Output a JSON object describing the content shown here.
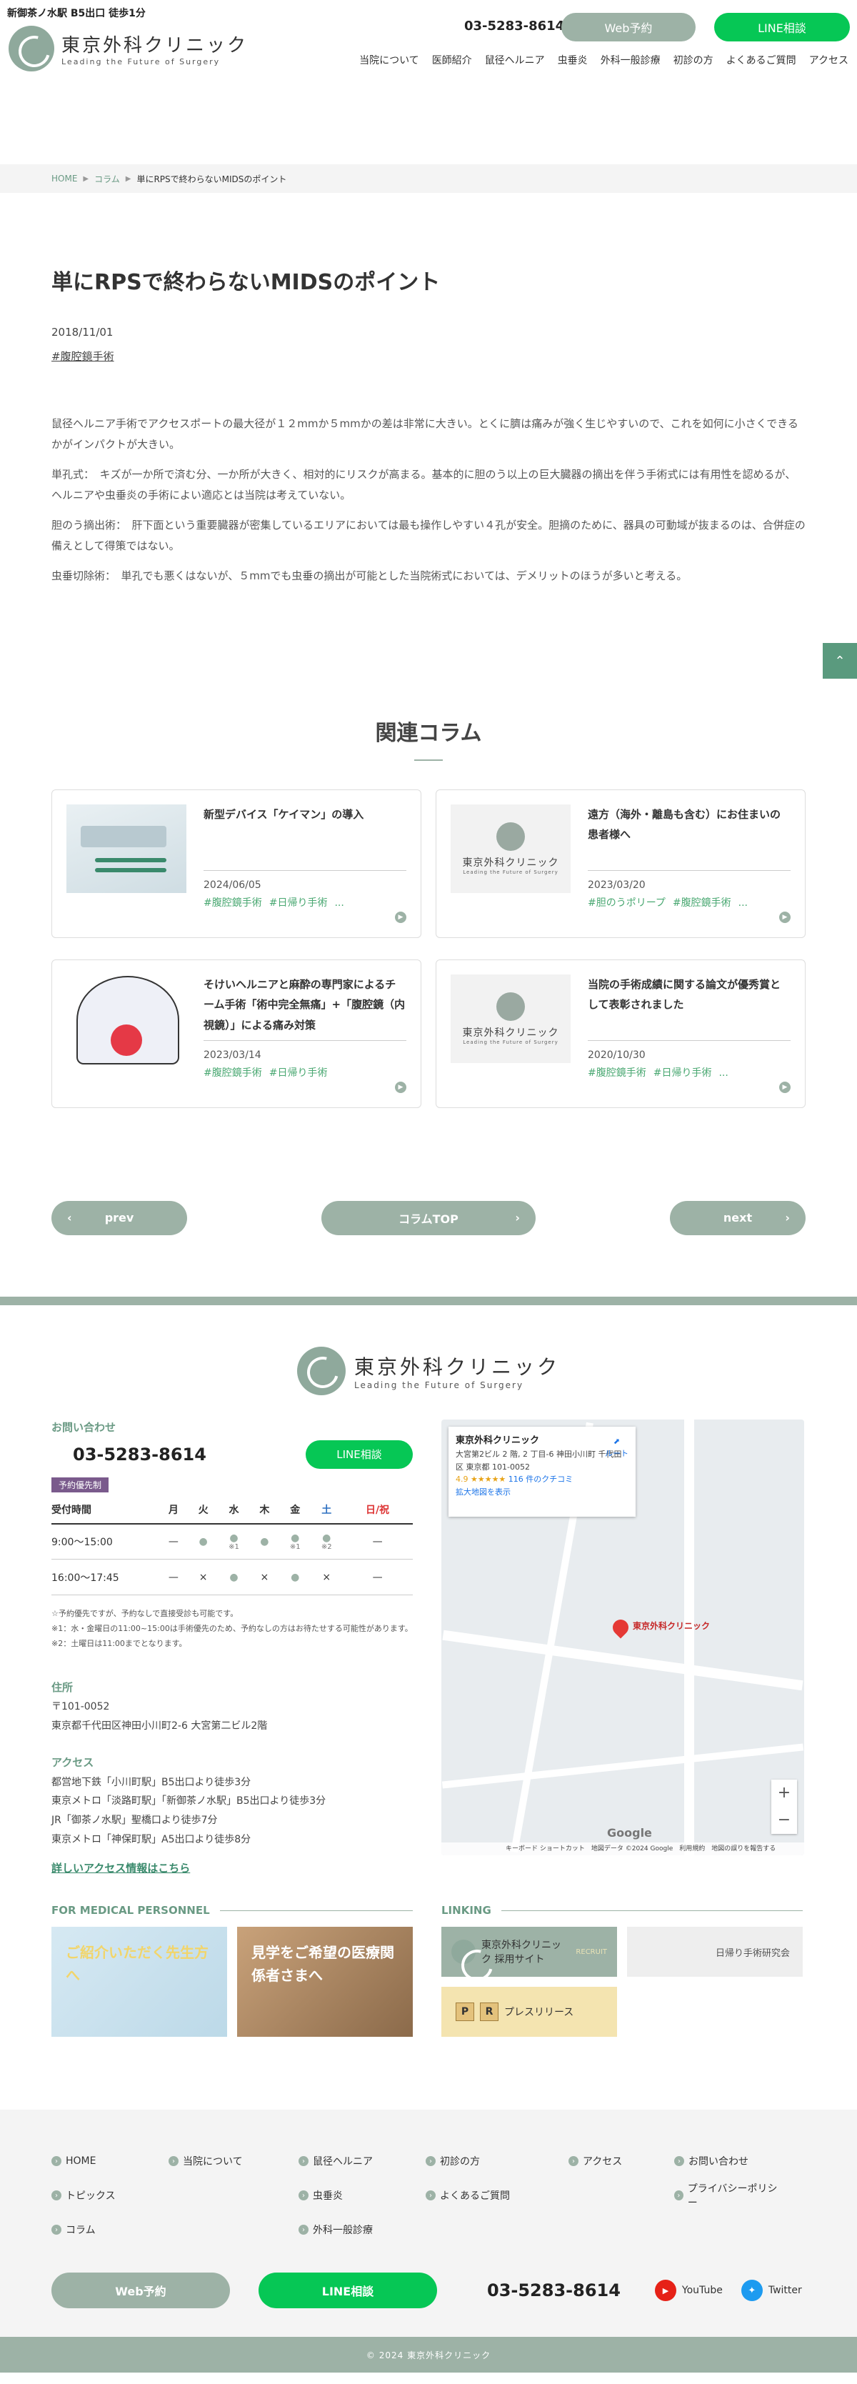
{
  "header": {
    "station": "新御茶ノ水駅 B5出口 徒歩1分",
    "logo_jp": "東京外科クリニック",
    "logo_en": "Leading the Future of Surgery",
    "phone": "03-5283-8614",
    "web_btn": "Web予約",
    "line_btn": "LINE相談",
    "nav": [
      "当院について",
      "医師紹介",
      "鼠径ヘルニア",
      "虫垂炎",
      "外科一般診療",
      "初診の方",
      "よくあるご質問",
      "アクセス"
    ]
  },
  "breadcrumb": {
    "home": "HOME",
    "column": "コラム",
    "current": "単にRPSで終わらないMIDSのポイント"
  },
  "article": {
    "title": "単にRPSで終わらないMIDSのポイント",
    "date": "2018/11/01",
    "tag": "#腹腔鏡手術",
    "paragraphs": [
      "鼠径ヘルニア手術でアクセスポートの最大径が１２mmか５mmかの差は非常に大きい。とくに臍は痛みが強く生じやすいので、これを如何に小さくできるかがインパクトが大きい。",
      "単孔式：　キズが一か所で済む分、一か所が大きく、相対的にリスクが高まる。基本的に胆のう以上の巨大臓器の摘出を伴う手術式には有用性を認めるが、ヘルニアや虫垂炎の手術によい適応とは当院は考えていない。",
      "胆のう摘出術：　肝下面という重要臓器が密集しているエリアにおいては最も操作しやすい４孔が安全。胆摘のために、器具の可動域が抜まるのは、合併症の備えとして得策ではない。",
      "虫垂切除術：　単孔でも悪くはないが、５mmでも虫垂の摘出が可能とした当院術式においては、デメリットのほうが多いと考える。"
    ]
  },
  "related": {
    "title": "関連コラム",
    "cards": [
      {
        "title": "新型デバイス「ケイマン」の導入",
        "date": "2024/06/05",
        "tags": [
          "#腹腔鏡手術",
          "#日帰り手術",
          "..."
        ],
        "thumb": "device"
      },
      {
        "title": "遠方（海外・離島も含む）にお住まいの患者様へ",
        "date": "2023/03/20",
        "tags": [
          "#胆のうポリープ",
          "#腹腔鏡手術",
          "..."
        ],
        "thumb": "logo"
      },
      {
        "title": "そけいヘルニアと麻酔の専門家によるチーム手術「術中完全無痛」+「腹腔鏡（内視鏡）」による痛み対策",
        "date": "2023/03/14",
        "tags": [
          "#腹腔鏡手術",
          "#日帰り手術"
        ],
        "thumb": "body"
      },
      {
        "title": "当院の手術成績に関する論文が優秀賞として表彰されました",
        "date": "2020/10/30",
        "tags": [
          "#腹腔鏡手術",
          "#日帰り手術",
          "..."
        ],
        "thumb": "logo"
      }
    ],
    "thumb_logo_jp": "東京外科クリニック",
    "thumb_logo_en": "Leading the Future of Surgery"
  },
  "pager": {
    "prev": "prev",
    "top": "コラムTOP",
    "next": "next"
  },
  "footer": {
    "logo_jp": "東京外科クリニック",
    "logo_en": "Leading the Future of Surgery",
    "contact_label": "お問い合わせ",
    "phone": "03-5283-8614",
    "line_btn": "LINE相談",
    "reservation_badge": "予約優先制",
    "hours": {
      "header": [
        "受付時間",
        "月",
        "火",
        "水",
        "木",
        "金",
        "土",
        "日/祝"
      ],
      "rows": [
        {
          "time": "9:00〜15:00",
          "cells": [
            "—",
            "●",
            "●",
            "●",
            "●",
            "●",
            "—"
          ],
          "subs": [
            "",
            "",
            "※1",
            "",
            "※1",
            "※2",
            ""
          ]
        },
        {
          "time": "16:00〜17:45",
          "cells": [
            "—",
            "×",
            "●",
            "×",
            "●",
            "×",
            "—"
          ],
          "subs": [
            "",
            "",
            "",
            "",
            "",
            "",
            ""
          ]
        }
      ]
    },
    "hours_notes": [
      "☆予約優先ですが、予約なしで直接受診も可能です。",
      "※1：水・金曜日の11:00~15:00は手術優先のため、予約なしの方はお待たせする可能性があります。",
      "※2：土曜日は11:00までとなります。"
    ],
    "address_label": "住所",
    "address": [
      "〒101-0052",
      "東京都千代田区神田小川町2-6 大宮第二ビル2階"
    ],
    "access_label": "アクセス",
    "access": [
      "都営地下鉄「小川町駅」B5出口より徒歩3分",
      "東京メトロ「淡路町駅」「新御茶ノ水駅」B5出口より徒歩3分",
      "JR「御茶ノ水駅」聖橋口より徒歩7分",
      "東京メトロ「神保町駅」A5出口より徒歩8分"
    ],
    "access_link": "詳しいアクセス情報はこちら",
    "map": {
      "name": "東京外科クリニック",
      "address": "大宮第2ビル 2 階, 2 丁目-6 神田小川町 千代田区 東京都 101-0052",
      "rating": "4.9 ★★★★★",
      "reviews": "116 件のクチコミ",
      "enlarge": "拡大地図を表示",
      "route": "ルート",
      "pin_label": "東京外科クリニック",
      "google": "Google",
      "credit": "キーボード ショートカット　地図データ ©2024 Google　利用規約　地図の誤りを報告する"
    },
    "medical_label": "FOR MEDICAL PERSONNEL",
    "banner_intro": "ご紹介いただく先生方へ",
    "banner_tour": "見学をご希望の医療関係者さまへ",
    "linking_label": "LINKING",
    "banner_recruit": "東京外科クリニック 採用サイト",
    "banner_recruit_sub": "RECRUIT",
    "banner_day": "日帰り手術研究会",
    "banner_pr": "プレスリリース",
    "links": [
      [
        "HOME",
        "当院について",
        "鼠径ヘルニア",
        "初診の方",
        "アクセス",
        "お問い合わせ"
      ],
      [
        "トピックス",
        "",
        "虫垂炎",
        "よくあるご質問",
        "",
        "プライバシーポリシー"
      ],
      [
        "コラム",
        "",
        "外科一般診療",
        "",
        "",
        ""
      ]
    ],
    "cta_web": "Web予約",
    "cta_line": "LINE相談",
    "cta_phone": "03-5283-8614",
    "youtube": "YouTube",
    "twitter": "Twitter",
    "copyright": "© 2024 東京外科クリニック"
  },
  "colors": {
    "accent": "#9db2a6",
    "line_green": "#06c755",
    "tag_green": "#4aa872"
  }
}
